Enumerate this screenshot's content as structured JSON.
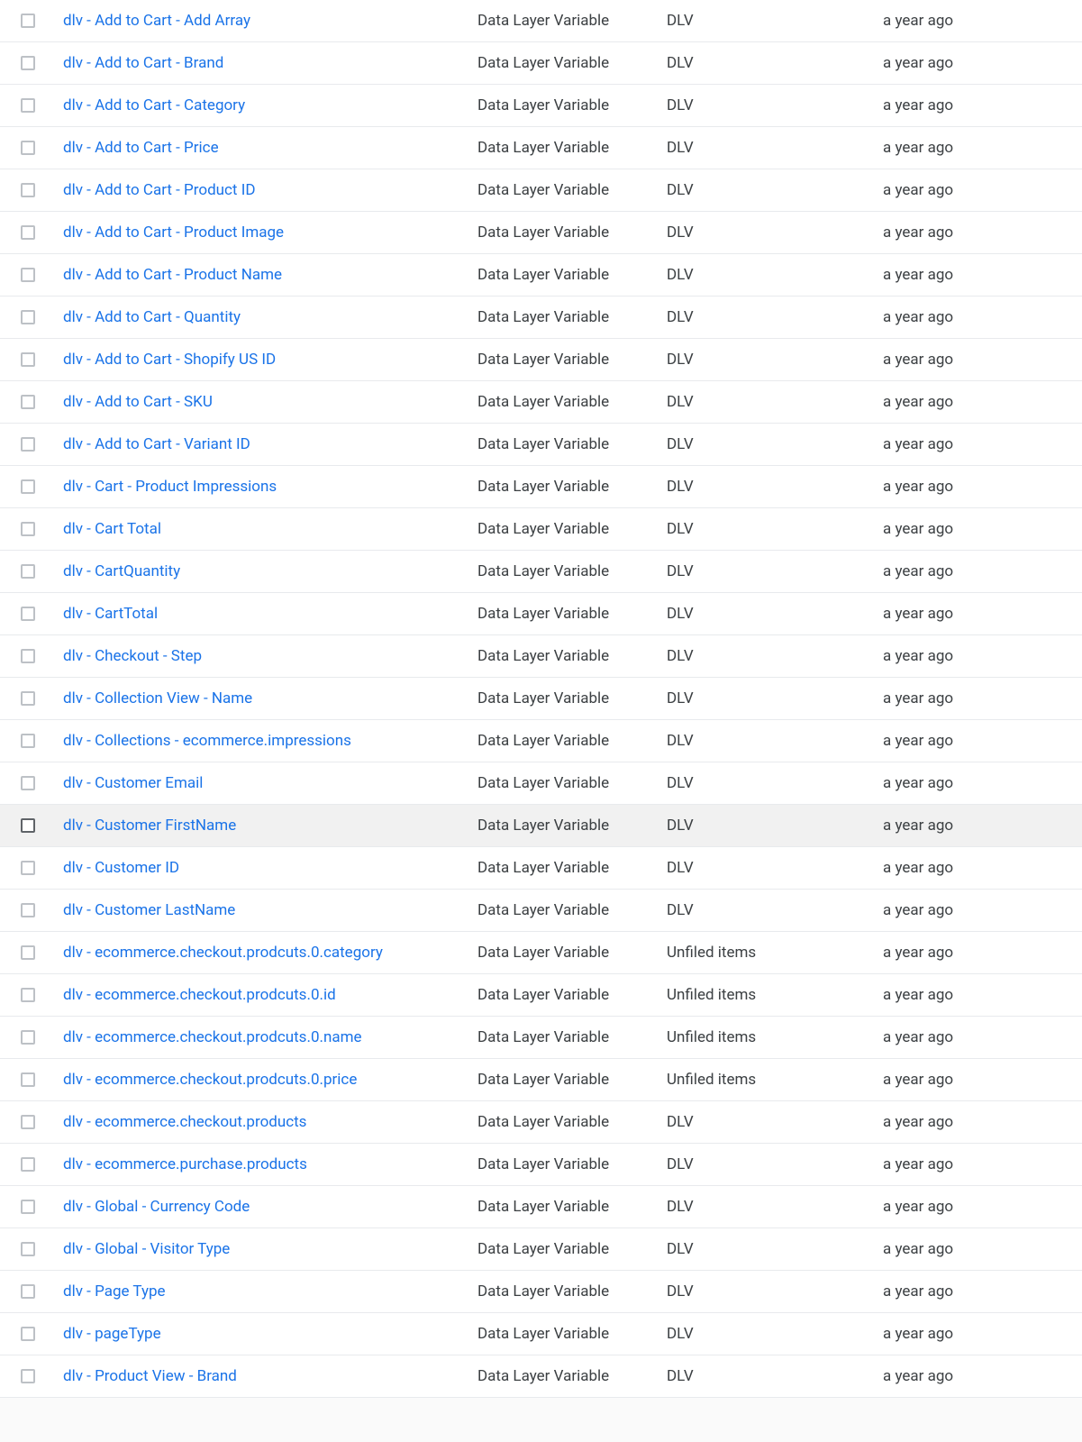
{
  "hovered_index": 19,
  "rows": [
    {
      "name": "dlv - Add to Cart - Add Array",
      "type": "Data Layer Variable",
      "folder": "DLV",
      "edited": "a year ago"
    },
    {
      "name": "dlv - Add to Cart - Brand",
      "type": "Data Layer Variable",
      "folder": "DLV",
      "edited": "a year ago"
    },
    {
      "name": "dlv - Add to Cart - Category",
      "type": "Data Layer Variable",
      "folder": "DLV",
      "edited": "a year ago"
    },
    {
      "name": "dlv - Add to Cart - Price",
      "type": "Data Layer Variable",
      "folder": "DLV",
      "edited": "a year ago"
    },
    {
      "name": "dlv - Add to Cart - Product ID",
      "type": "Data Layer Variable",
      "folder": "DLV",
      "edited": "a year ago"
    },
    {
      "name": "dlv - Add to Cart - Product Image",
      "type": "Data Layer Variable",
      "folder": "DLV",
      "edited": "a year ago"
    },
    {
      "name": "dlv - Add to Cart - Product Name",
      "type": "Data Layer Variable",
      "folder": "DLV",
      "edited": "a year ago"
    },
    {
      "name": "dlv - Add to Cart - Quantity",
      "type": "Data Layer Variable",
      "folder": "DLV",
      "edited": "a year ago"
    },
    {
      "name": "dlv - Add to Cart - Shopify US ID",
      "type": "Data Layer Variable",
      "folder": "DLV",
      "edited": "a year ago"
    },
    {
      "name": "dlv - Add to Cart - SKU",
      "type": "Data Layer Variable",
      "folder": "DLV",
      "edited": "a year ago"
    },
    {
      "name": "dlv - Add to Cart - Variant ID",
      "type": "Data Layer Variable",
      "folder": "DLV",
      "edited": "a year ago"
    },
    {
      "name": "dlv - Cart - Product Impressions",
      "type": "Data Layer Variable",
      "folder": "DLV",
      "edited": "a year ago"
    },
    {
      "name": "dlv - Cart Total",
      "type": "Data Layer Variable",
      "folder": "DLV",
      "edited": "a year ago"
    },
    {
      "name": "dlv - CartQuantity",
      "type": "Data Layer Variable",
      "folder": "DLV",
      "edited": "a year ago"
    },
    {
      "name": "dlv - CartTotal",
      "type": "Data Layer Variable",
      "folder": "DLV",
      "edited": "a year ago"
    },
    {
      "name": "dlv - Checkout - Step",
      "type": "Data Layer Variable",
      "folder": "DLV",
      "edited": "a year ago"
    },
    {
      "name": "dlv - Collection View - Name",
      "type": "Data Layer Variable",
      "folder": "DLV",
      "edited": "a year ago"
    },
    {
      "name": "dlv - Collections - ecommerce.impressions",
      "type": "Data Layer Variable",
      "folder": "DLV",
      "edited": "a year ago"
    },
    {
      "name": "dlv - Customer Email",
      "type": "Data Layer Variable",
      "folder": "DLV",
      "edited": "a year ago"
    },
    {
      "name": "dlv - Customer FirstName",
      "type": "Data Layer Variable",
      "folder": "DLV",
      "edited": "a year ago"
    },
    {
      "name": "dlv - Customer ID",
      "type": "Data Layer Variable",
      "folder": "DLV",
      "edited": "a year ago"
    },
    {
      "name": "dlv - Customer LastName",
      "type": "Data Layer Variable",
      "folder": "DLV",
      "edited": "a year ago"
    },
    {
      "name": "dlv - ecommerce.checkout.prodcuts.0.category",
      "type": "Data Layer Variable",
      "folder": "Unfiled items",
      "edited": "a year ago"
    },
    {
      "name": "dlv - ecommerce.checkout.prodcuts.0.id",
      "type": "Data Layer Variable",
      "folder": "Unfiled items",
      "edited": "a year ago"
    },
    {
      "name": "dlv - ecommerce.checkout.prodcuts.0.name",
      "type": "Data Layer Variable",
      "folder": "Unfiled items",
      "edited": "a year ago"
    },
    {
      "name": "dlv - ecommerce.checkout.prodcuts.0.price",
      "type": "Data Layer Variable",
      "folder": "Unfiled items",
      "edited": "a year ago"
    },
    {
      "name": "dlv - ecommerce.checkout.products",
      "type": "Data Layer Variable",
      "folder": "DLV",
      "edited": "a year ago"
    },
    {
      "name": "dlv - ecommerce.purchase.products",
      "type": "Data Layer Variable",
      "folder": "DLV",
      "edited": "a year ago"
    },
    {
      "name": "dlv - Global - Currency Code",
      "type": "Data Layer Variable",
      "folder": "DLV",
      "edited": "a year ago"
    },
    {
      "name": "dlv - Global - Visitor Type",
      "type": "Data Layer Variable",
      "folder": "DLV",
      "edited": "a year ago"
    },
    {
      "name": "dlv - Page Type",
      "type": "Data Layer Variable",
      "folder": "DLV",
      "edited": "a year ago"
    },
    {
      "name": "dlv - pageType",
      "type": "Data Layer Variable",
      "folder": "DLV",
      "edited": "a year ago"
    },
    {
      "name": "dlv - Product View - Brand",
      "type": "Data Layer Variable",
      "folder": "DLV",
      "edited": "a year ago"
    }
  ]
}
